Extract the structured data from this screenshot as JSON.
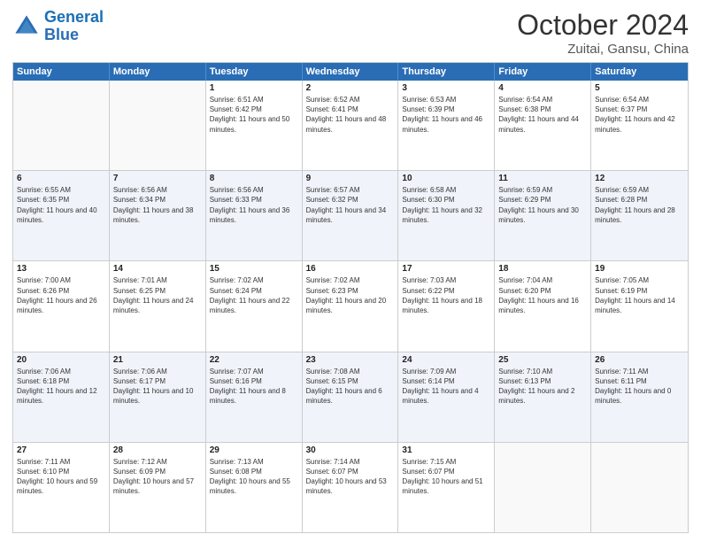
{
  "header": {
    "logo_general": "General",
    "logo_blue": "Blue",
    "month": "October 2024",
    "location": "Zuitai, Gansu, China"
  },
  "weekdays": [
    "Sunday",
    "Monday",
    "Tuesday",
    "Wednesday",
    "Thursday",
    "Friday",
    "Saturday"
  ],
  "rows": [
    [
      {
        "day": "",
        "sunrise": "",
        "sunset": "",
        "daylight": "",
        "empty": true
      },
      {
        "day": "",
        "sunrise": "",
        "sunset": "",
        "daylight": "",
        "empty": true
      },
      {
        "day": "1",
        "sunrise": "Sunrise: 6:51 AM",
        "sunset": "Sunset: 6:42 PM",
        "daylight": "Daylight: 11 hours and 50 minutes.",
        "empty": false
      },
      {
        "day": "2",
        "sunrise": "Sunrise: 6:52 AM",
        "sunset": "Sunset: 6:41 PM",
        "daylight": "Daylight: 11 hours and 48 minutes.",
        "empty": false
      },
      {
        "day": "3",
        "sunrise": "Sunrise: 6:53 AM",
        "sunset": "Sunset: 6:39 PM",
        "daylight": "Daylight: 11 hours and 46 minutes.",
        "empty": false
      },
      {
        "day": "4",
        "sunrise": "Sunrise: 6:54 AM",
        "sunset": "Sunset: 6:38 PM",
        "daylight": "Daylight: 11 hours and 44 minutes.",
        "empty": false
      },
      {
        "day": "5",
        "sunrise": "Sunrise: 6:54 AM",
        "sunset": "Sunset: 6:37 PM",
        "daylight": "Daylight: 11 hours and 42 minutes.",
        "empty": false
      }
    ],
    [
      {
        "day": "6",
        "sunrise": "Sunrise: 6:55 AM",
        "sunset": "Sunset: 6:35 PM",
        "daylight": "Daylight: 11 hours and 40 minutes.",
        "empty": false
      },
      {
        "day": "7",
        "sunrise": "Sunrise: 6:56 AM",
        "sunset": "Sunset: 6:34 PM",
        "daylight": "Daylight: 11 hours and 38 minutes.",
        "empty": false
      },
      {
        "day": "8",
        "sunrise": "Sunrise: 6:56 AM",
        "sunset": "Sunset: 6:33 PM",
        "daylight": "Daylight: 11 hours and 36 minutes.",
        "empty": false
      },
      {
        "day": "9",
        "sunrise": "Sunrise: 6:57 AM",
        "sunset": "Sunset: 6:32 PM",
        "daylight": "Daylight: 11 hours and 34 minutes.",
        "empty": false
      },
      {
        "day": "10",
        "sunrise": "Sunrise: 6:58 AM",
        "sunset": "Sunset: 6:30 PM",
        "daylight": "Daylight: 11 hours and 32 minutes.",
        "empty": false
      },
      {
        "day": "11",
        "sunrise": "Sunrise: 6:59 AM",
        "sunset": "Sunset: 6:29 PM",
        "daylight": "Daylight: 11 hours and 30 minutes.",
        "empty": false
      },
      {
        "day": "12",
        "sunrise": "Sunrise: 6:59 AM",
        "sunset": "Sunset: 6:28 PM",
        "daylight": "Daylight: 11 hours and 28 minutes.",
        "empty": false
      }
    ],
    [
      {
        "day": "13",
        "sunrise": "Sunrise: 7:00 AM",
        "sunset": "Sunset: 6:26 PM",
        "daylight": "Daylight: 11 hours and 26 minutes.",
        "empty": false
      },
      {
        "day": "14",
        "sunrise": "Sunrise: 7:01 AM",
        "sunset": "Sunset: 6:25 PM",
        "daylight": "Daylight: 11 hours and 24 minutes.",
        "empty": false
      },
      {
        "day": "15",
        "sunrise": "Sunrise: 7:02 AM",
        "sunset": "Sunset: 6:24 PM",
        "daylight": "Daylight: 11 hours and 22 minutes.",
        "empty": false
      },
      {
        "day": "16",
        "sunrise": "Sunrise: 7:02 AM",
        "sunset": "Sunset: 6:23 PM",
        "daylight": "Daylight: 11 hours and 20 minutes.",
        "empty": false
      },
      {
        "day": "17",
        "sunrise": "Sunrise: 7:03 AM",
        "sunset": "Sunset: 6:22 PM",
        "daylight": "Daylight: 11 hours and 18 minutes.",
        "empty": false
      },
      {
        "day": "18",
        "sunrise": "Sunrise: 7:04 AM",
        "sunset": "Sunset: 6:20 PM",
        "daylight": "Daylight: 11 hours and 16 minutes.",
        "empty": false
      },
      {
        "day": "19",
        "sunrise": "Sunrise: 7:05 AM",
        "sunset": "Sunset: 6:19 PM",
        "daylight": "Daylight: 11 hours and 14 minutes.",
        "empty": false
      }
    ],
    [
      {
        "day": "20",
        "sunrise": "Sunrise: 7:06 AM",
        "sunset": "Sunset: 6:18 PM",
        "daylight": "Daylight: 11 hours and 12 minutes.",
        "empty": false
      },
      {
        "day": "21",
        "sunrise": "Sunrise: 7:06 AM",
        "sunset": "Sunset: 6:17 PM",
        "daylight": "Daylight: 11 hours and 10 minutes.",
        "empty": false
      },
      {
        "day": "22",
        "sunrise": "Sunrise: 7:07 AM",
        "sunset": "Sunset: 6:16 PM",
        "daylight": "Daylight: 11 hours and 8 minutes.",
        "empty": false
      },
      {
        "day": "23",
        "sunrise": "Sunrise: 7:08 AM",
        "sunset": "Sunset: 6:15 PM",
        "daylight": "Daylight: 11 hours and 6 minutes.",
        "empty": false
      },
      {
        "day": "24",
        "sunrise": "Sunrise: 7:09 AM",
        "sunset": "Sunset: 6:14 PM",
        "daylight": "Daylight: 11 hours and 4 minutes.",
        "empty": false
      },
      {
        "day": "25",
        "sunrise": "Sunrise: 7:10 AM",
        "sunset": "Sunset: 6:13 PM",
        "daylight": "Daylight: 11 hours and 2 minutes.",
        "empty": false
      },
      {
        "day": "26",
        "sunrise": "Sunrise: 7:11 AM",
        "sunset": "Sunset: 6:11 PM",
        "daylight": "Daylight: 11 hours and 0 minutes.",
        "empty": false
      }
    ],
    [
      {
        "day": "27",
        "sunrise": "Sunrise: 7:11 AM",
        "sunset": "Sunset: 6:10 PM",
        "daylight": "Daylight: 10 hours and 59 minutes.",
        "empty": false
      },
      {
        "day": "28",
        "sunrise": "Sunrise: 7:12 AM",
        "sunset": "Sunset: 6:09 PM",
        "daylight": "Daylight: 10 hours and 57 minutes.",
        "empty": false
      },
      {
        "day": "29",
        "sunrise": "Sunrise: 7:13 AM",
        "sunset": "Sunset: 6:08 PM",
        "daylight": "Daylight: 10 hours and 55 minutes.",
        "empty": false
      },
      {
        "day": "30",
        "sunrise": "Sunrise: 7:14 AM",
        "sunset": "Sunset: 6:07 PM",
        "daylight": "Daylight: 10 hours and 53 minutes.",
        "empty": false
      },
      {
        "day": "31",
        "sunrise": "Sunrise: 7:15 AM",
        "sunset": "Sunset: 6:07 PM",
        "daylight": "Daylight: 10 hours and 51 minutes.",
        "empty": false
      },
      {
        "day": "",
        "sunrise": "",
        "sunset": "",
        "daylight": "",
        "empty": true
      },
      {
        "day": "",
        "sunrise": "",
        "sunset": "",
        "daylight": "",
        "empty": true
      }
    ]
  ],
  "colors": {
    "header_bg": "#2a6db5",
    "alt_row_bg": "#eef2fa",
    "cell_border": "#cccccc"
  }
}
